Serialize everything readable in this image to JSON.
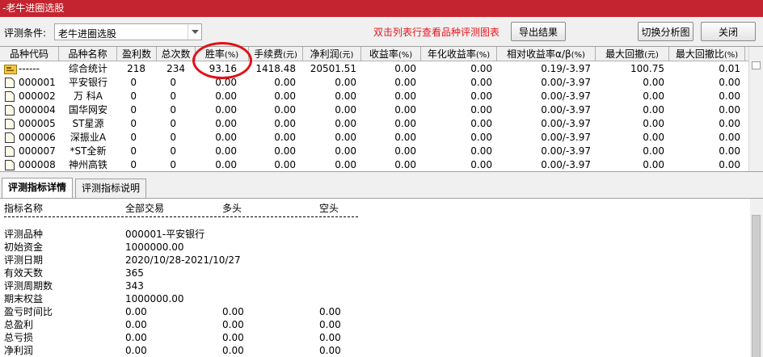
{
  "window": {
    "title": "-老牛进圈选股"
  },
  "toolbar": {
    "condition_label": "评测条件:",
    "condition_value": "老牛进圈选股",
    "hint": "双击列表行查看品种评测图表",
    "export_label": "导出结果",
    "switch_label": "切换分析图",
    "close_label": "关闭"
  },
  "grid": {
    "columns": [
      {
        "label": "品种代码",
        "unit": ""
      },
      {
        "label": "品种名称",
        "unit": ""
      },
      {
        "label": "盈利数",
        "unit": ""
      },
      {
        "label": "总次数",
        "unit": ""
      },
      {
        "label": "胜率",
        "unit": "(%)"
      },
      {
        "label": "手续费",
        "unit": "(元)"
      },
      {
        "label": "净利润",
        "unit": "(元)"
      },
      {
        "label": "收益率",
        "unit": "(%)"
      },
      {
        "label": "年化收益率",
        "unit": "(%)"
      },
      {
        "label": "相对收益率α/β",
        "unit": "(%)"
      },
      {
        "label": "最大回撤",
        "unit": "(元)"
      },
      {
        "label": "最大回撤比",
        "unit": "(%)"
      }
    ],
    "summary": {
      "code": "------",
      "name": "综合统计",
      "wins": "218",
      "total": "234",
      "win_rate": "93.16",
      "fee": "1418.48",
      "net_profit": "20501.51",
      "return": "0.00",
      "annual_return": "0.00",
      "relative": "0.19/-3.97",
      "max_drawdown": "100.75",
      "max_drawdown_ratio": "0.01"
    },
    "rows": [
      {
        "code": "000001",
        "name": "平安银行",
        "wins": "0",
        "total": "0",
        "win_rate": "0.00",
        "fee": "0.00",
        "net_profit": "0.00",
        "return": "0.00",
        "annual_return": "0.00",
        "relative": "0.00/-3.97",
        "max_drawdown": "0.00",
        "max_drawdown_ratio": "0.00"
      },
      {
        "code": "000002",
        "name": "万  科A",
        "wins": "0",
        "total": "0",
        "win_rate": "0.00",
        "fee": "0.00",
        "net_profit": "0.00",
        "return": "0.00",
        "annual_return": "0.00",
        "relative": "0.00/-3.97",
        "max_drawdown": "0.00",
        "max_drawdown_ratio": "0.00"
      },
      {
        "code": "000004",
        "name": "国华网安",
        "wins": "0",
        "total": "0",
        "win_rate": "0.00",
        "fee": "0.00",
        "net_profit": "0.00",
        "return": "0.00",
        "annual_return": "0.00",
        "relative": "0.00/-3.97",
        "max_drawdown": "0.00",
        "max_drawdown_ratio": "0.00"
      },
      {
        "code": "000005",
        "name": "ST星源",
        "wins": "0",
        "total": "0",
        "win_rate": "0.00",
        "fee": "0.00",
        "net_profit": "0.00",
        "return": "0.00",
        "annual_return": "0.00",
        "relative": "0.00/-3.97",
        "max_drawdown": "0.00",
        "max_drawdown_ratio": "0.00"
      },
      {
        "code": "000006",
        "name": "深振业A",
        "wins": "0",
        "total": "0",
        "win_rate": "0.00",
        "fee": "0.00",
        "net_profit": "0.00",
        "return": "0.00",
        "annual_return": "0.00",
        "relative": "0.00/-3.97",
        "max_drawdown": "0.00",
        "max_drawdown_ratio": "0.00"
      },
      {
        "code": "000007",
        "name": "*ST全新",
        "wins": "0",
        "total": "0",
        "win_rate": "0.00",
        "fee": "0.00",
        "net_profit": "0.00",
        "return": "0.00",
        "annual_return": "0.00",
        "relative": "0.00/-3.97",
        "max_drawdown": "0.00",
        "max_drawdown_ratio": "0.00"
      },
      {
        "code": "000008",
        "name": "神州高铁",
        "wins": "0",
        "total": "0",
        "win_rate": "0.00",
        "fee": "0.00",
        "net_profit": "0.00",
        "return": "0.00",
        "annual_return": "0.00",
        "relative": "0.00/-3.97",
        "max_drawdown": "0.00",
        "max_drawdown_ratio": "0.00"
      }
    ]
  },
  "tabs": [
    {
      "label": "评测指标详情"
    },
    {
      "label": "评测指标说明"
    }
  ],
  "detail": {
    "headers": [
      "指标名称",
      "全部交易",
      "多头",
      "空头"
    ],
    "lines": [
      {
        "name": "评测品种",
        "all": "000001-平安银行",
        "long": "",
        "short": ""
      },
      {
        "name": "初始资金",
        "all": "1000000.00",
        "long": "",
        "short": ""
      },
      {
        "name": "评测日期",
        "all": "2020/10/28-2021/10/27",
        "long": "",
        "short": ""
      },
      {
        "name": "有效天数",
        "all": "365",
        "long": "",
        "short": ""
      },
      {
        "name": "评测周期数",
        "all": "343",
        "long": "",
        "short": ""
      },
      {
        "name": "期末权益",
        "all": "1000000.00",
        "long": "",
        "short": ""
      },
      {
        "name": "盈亏时间比",
        "all": "0.00",
        "long": "0.00",
        "short": "0.00"
      },
      {
        "name": "总盈利",
        "all": "0.00",
        "long": "0.00",
        "short": "0.00"
      },
      {
        "name": "总亏损",
        "all": "0.00",
        "long": "0.00",
        "short": "0.00"
      },
      {
        "name": "净利润",
        "all": "0.00",
        "long": "0.00",
        "short": "0.00"
      }
    ]
  },
  "colors": {
    "title_bg": "#c4242f",
    "hint": "#e8141d",
    "highlight_circle": "#e01018"
  }
}
